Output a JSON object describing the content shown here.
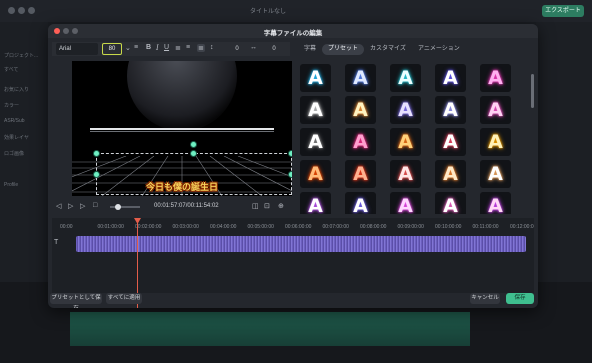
{
  "background": {
    "window_title": "タイトルなし",
    "export_label": "エクスポート",
    "left_items": [
      "プロジェクト...",
      "すべて",
      "お気に入り",
      "カラー",
      "ASR/Sub",
      "効果レイヤ",
      "ロゴ画像",
      "Profile"
    ]
  },
  "dialog": {
    "title": "字幕ファイルの編集",
    "toolbar": {
      "font_family": "Arial",
      "font_size": "80",
      "line_height": "0",
      "letter_spacing": "0"
    },
    "preview": {
      "caption": "今日も僕の誕生日"
    },
    "playback": {
      "timecode": "00:01:57:07/00:11:54:02"
    },
    "tabs": [
      "字幕",
      "プリセット",
      "カスタマイズ",
      "アニメーション"
    ],
    "active_tab": "プリセット",
    "presets": {
      "glyph": "A",
      "tiles": [
        {
          "fill": "#ffffff",
          "glow": "#27c4ff"
        },
        {
          "fill": "#dfe9ff",
          "glow": "#5d8bff"
        },
        {
          "fill": "#eaffff",
          "glow": "#29d8e8"
        },
        {
          "fill": "#ffffff",
          "glow": "#6a5cff"
        },
        {
          "fill": "#ffb0f0",
          "glow": "#ff3ec8"
        },
        {
          "fill": "#ffffff",
          "glow": "#cfcfcf"
        },
        {
          "fill": "#fff2c0",
          "glow": "#ff9a3c"
        },
        {
          "fill": "#e7e0ff",
          "glow": "#8f7cff"
        },
        {
          "fill": "#ffffff",
          "glow": "#a0a0ff"
        },
        {
          "fill": "#ffd1f3",
          "glow": "#ff5ad0"
        },
        {
          "fill": "#ffffff",
          "glow": "#8a8a8a"
        },
        {
          "fill": "#ff9fce",
          "glow": "#ff2e8d"
        },
        {
          "fill": "#ffd07a",
          "glow": "#ff7a1a"
        },
        {
          "fill": "#ffffff",
          "glow": "#ff4a6b"
        },
        {
          "fill": "#fff1b8",
          "glow": "#ffa800"
        },
        {
          "fill": "#ffbb7a",
          "glow": "#ff4d00"
        },
        {
          "fill": "#ffb08f",
          "glow": "#ff3a1a"
        },
        {
          "fill": "#ffe6e6",
          "glow": "#ff5a5a"
        },
        {
          "fill": "#ffe9c7",
          "glow": "#ff8d33"
        },
        {
          "fill": "#ffffff",
          "glow": "#ffb36b"
        },
        {
          "fill": "#ffffff",
          "glow": "#c85cff"
        },
        {
          "fill": "#ffffff",
          "glow": "#7e6bff"
        },
        {
          "fill": "#ffd6ff",
          "glow": "#ff55ff"
        },
        {
          "fill": "#ffffff",
          "glow": "#ff6dd3"
        },
        {
          "fill": "#ffd8f7",
          "glow": "#d94bff"
        }
      ]
    },
    "ruler": [
      "00:00",
      "00:01:00:00",
      "00:02:00:00",
      "00:03:00:00",
      "00:04:00:00",
      "00:05:00:00",
      "00:06:00:00",
      "00:07:00:00",
      "00:08:00:00",
      "00:09:00:00",
      "00:10:00:00",
      "00:11:00:00",
      "00:12:00:0"
    ],
    "footer": {
      "save_preset": "プリセットとして保存",
      "apply_all": "すべてに適用",
      "cancel": "キャンセル",
      "save": "保存"
    }
  }
}
